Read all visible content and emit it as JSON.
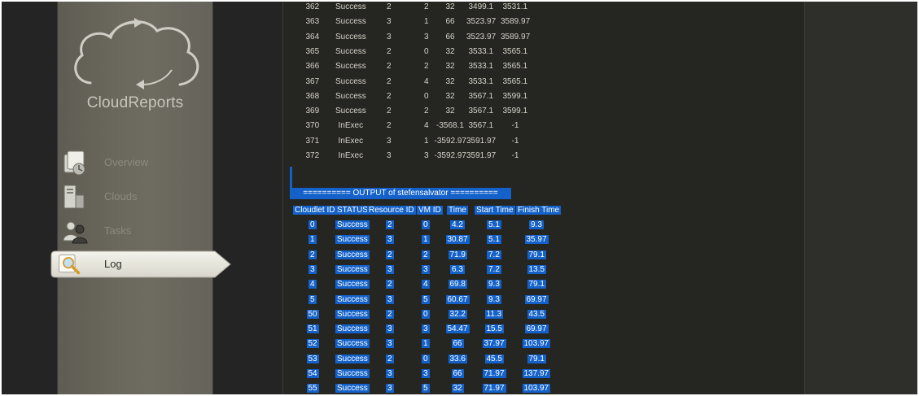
{
  "app": {
    "name": "CloudReports"
  },
  "nav": {
    "items": [
      {
        "label": "Overview",
        "icon": "overview-icon"
      },
      {
        "label": "Clouds",
        "icon": "server-icon"
      },
      {
        "label": "Tasks",
        "icon": "users-icon"
      },
      {
        "label": "Log",
        "icon": "magnifier-icon",
        "active": true
      }
    ]
  },
  "log": {
    "previous_rows": [
      [
        "362",
        "Success",
        "2",
        "2",
        "32",
        "3499.1",
        "3531.1"
      ],
      [
        "363",
        "Success",
        "3",
        "1",
        "66",
        "3523.97",
        "3589.97"
      ],
      [
        "364",
        "Success",
        "3",
        "3",
        "66",
        "3523.97",
        "3589.97"
      ],
      [
        "365",
        "Success",
        "2",
        "0",
        "32",
        "3533.1",
        "3565.1"
      ],
      [
        "366",
        "Success",
        "2",
        "2",
        "32",
        "3533.1",
        "3565.1"
      ],
      [
        "367",
        "Success",
        "2",
        "4",
        "32",
        "3533.1",
        "3565.1"
      ],
      [
        "368",
        "Success",
        "2",
        "0",
        "32",
        "3567.1",
        "3599.1"
      ],
      [
        "369",
        "Success",
        "2",
        "2",
        "32",
        "3567.1",
        "3599.1"
      ],
      [
        "370",
        "InExec",
        "2",
        "4",
        "-3568.1",
        "3567.1",
        "-1"
      ],
      [
        "371",
        "InExec",
        "3",
        "1",
        "-3592.97",
        "3591.97",
        "-1"
      ],
      [
        "372",
        "InExec",
        "3",
        "3",
        "-3592.97",
        "3591.97",
        "-1"
      ]
    ],
    "section_title": "========== OUTPUT of stefensalvator ==========",
    "columns": [
      "Cloudlet ID",
      "STATUS",
      "Resource ID",
      "VM ID",
      "Time",
      "Start Time",
      "Finish Time"
    ],
    "output_rows": [
      [
        "0",
        "Success",
        "2",
        "0",
        "4.2",
        "5.1",
        "9.3"
      ],
      [
        "1",
        "Success",
        "3",
        "1",
        "30.87",
        "5.1",
        "35.97"
      ],
      [
        "2",
        "Success",
        "2",
        "2",
        "71.9",
        "7.2",
        "79.1"
      ],
      [
        "3",
        "Success",
        "3",
        "3",
        "6.3",
        "7.2",
        "13.5"
      ],
      [
        "4",
        "Success",
        "2",
        "4",
        "69.8",
        "9.3",
        "79.1"
      ],
      [
        "5",
        "Success",
        "3",
        "5",
        "60.67",
        "9.3",
        "69.97"
      ],
      [
        "50",
        "Success",
        "2",
        "0",
        "32.2",
        "11.3",
        "43.5"
      ],
      [
        "51",
        "Success",
        "3",
        "3",
        "54.47",
        "15.5",
        "69.97"
      ],
      [
        "52",
        "Success",
        "3",
        "1",
        "66",
        "37.97",
        "103.97"
      ],
      [
        "53",
        "Success",
        "2",
        "0",
        "33.6",
        "45.5",
        "79.1"
      ],
      [
        "54",
        "Success",
        "3",
        "3",
        "66",
        "71.97",
        "137.97"
      ],
      [
        "55",
        "Success",
        "3",
        "5",
        "32",
        "71.97",
        "103.97"
      ]
    ]
  },
  "colors": {
    "selection": "#1462c9",
    "panel_bg": "#252522",
    "sidebar_bg": "#6b695e",
    "log_text": "#d6d4c8"
  }
}
